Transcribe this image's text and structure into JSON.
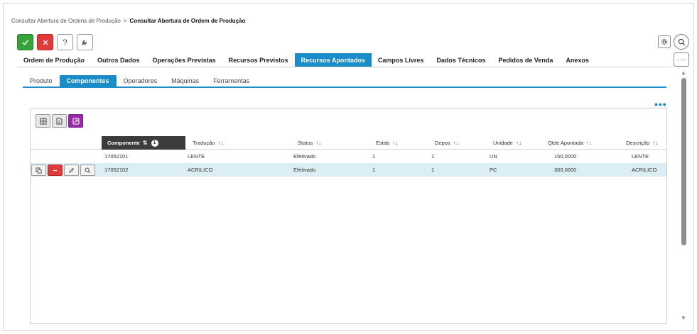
{
  "breadcrumb": {
    "parent": "Consultar Abertura de Ordens de Produção",
    "separator": ">",
    "current": "Consultar Abertura de Ordem de Produção"
  },
  "toolbar": {
    "confirm_icon": "check-icon",
    "cancel_icon": "close-icon",
    "help_label": "?",
    "tools_icon": "wrench-icon"
  },
  "top_right": {
    "settings_icon": "gear-icon",
    "search_icon": "search-icon",
    "more_label": "···"
  },
  "tabs": [
    {
      "label": "Ordem de Produção",
      "active": false
    },
    {
      "label": "Outros Dados",
      "active": false
    },
    {
      "label": "Operações Previstas",
      "active": false
    },
    {
      "label": "Recursos Previstos",
      "active": false
    },
    {
      "label": "Recursos Apontados",
      "active": true
    },
    {
      "label": "Campos Livres",
      "active": false
    },
    {
      "label": "Dados Técnicos",
      "active": false
    },
    {
      "label": "Pedidos de Venda",
      "active": false
    },
    {
      "label": "Anexos",
      "active": false
    }
  ],
  "subtabs": [
    {
      "label": "Produto",
      "active": false
    },
    {
      "label": "Componentes",
      "active": true
    },
    {
      "label": "Operadores",
      "active": false
    },
    {
      "label": "Máquinas",
      "active": false
    },
    {
      "label": "Ferramentas",
      "active": false
    }
  ],
  "more_options_label": "•••",
  "grid": {
    "columns": [
      {
        "label": "Componente",
        "sort": "⇅",
        "badge": "1"
      },
      {
        "label": "Tradução",
        "sort": "↑↓"
      },
      {
        "label": "Status",
        "sort": "↑↓"
      },
      {
        "label": "Estab",
        "sort": "↑↓"
      },
      {
        "label": "Depos",
        "sort": "↑↓"
      },
      {
        "label": "Unidade",
        "sort": "↑↓"
      },
      {
        "label": "Qtde Apontada",
        "sort": "↑↓"
      },
      {
        "label": "Descrição",
        "sort": "↑↓"
      }
    ],
    "rows": [
      [
        "17052101",
        "LENTE",
        "Efetivado",
        "1",
        "1",
        "UN",
        "150,0000",
        "LENTE"
      ],
      [
        "17052102",
        "ACRILICO",
        "Efetivado",
        "1",
        "1",
        "PC",
        "300,0000",
        "ACRILICO"
      ]
    ],
    "selected_row": 1,
    "accent_color": "#1a8cc7",
    "selected_row_color": "#dbeef4"
  }
}
